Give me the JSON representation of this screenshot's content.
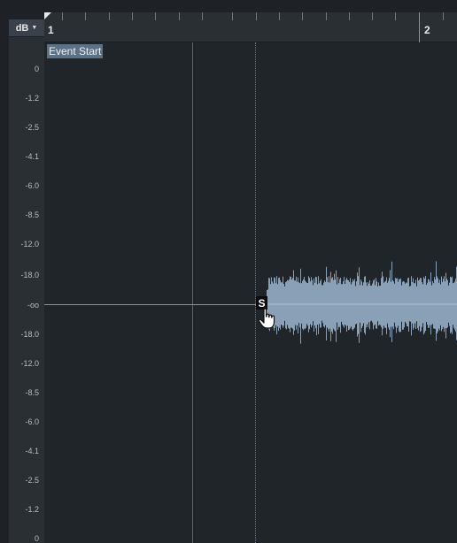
{
  "ruler": {
    "unit_label": "dB",
    "bars": [
      "1",
      "2"
    ]
  },
  "event": {
    "start_label": "Event Start",
    "marker_label": "S"
  },
  "db_scale": [
    "0",
    "-1.2",
    "-2.5",
    "-4.1",
    "-6.0",
    "-8.5",
    "-12.0",
    "-18.0",
    "-oo",
    "-18.0",
    "-12.0",
    "-8.5",
    "-6.0",
    "-4.1",
    "-2.5",
    "-1.2",
    "0"
  ],
  "colors": {
    "background": "#202529",
    "ruler": "#2a2f34",
    "waveform": "#8aa0b6",
    "cursor_line": "#3f6a8a",
    "event_label_bg": "#5b7185"
  },
  "icons": {
    "dropdown": "caret-down-icon",
    "cursor": "hand-pointer-icon"
  }
}
